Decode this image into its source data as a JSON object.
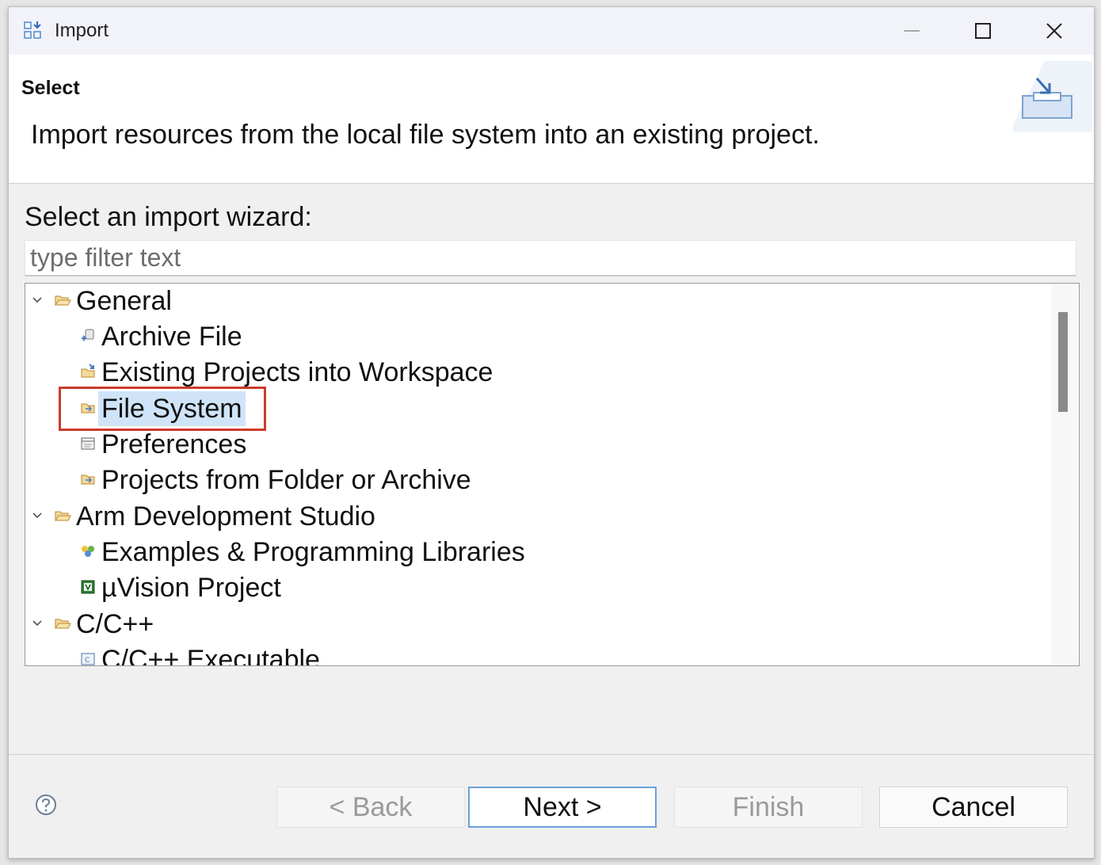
{
  "window": {
    "title": "Import",
    "icons": {
      "app": "import-wizard-icon",
      "minimize": "minimize-icon",
      "maximize": "maximize-icon",
      "close": "close-icon"
    }
  },
  "header": {
    "title": "Select",
    "description": "Import resources from the local file system into an existing project.",
    "banner_icon": "import-banner-icon"
  },
  "wizard": {
    "label": "Select an import wizard:",
    "filter_placeholder": "type filter text",
    "tree": [
      {
        "label": "General",
        "type": "category",
        "icon": "folder-open-icon",
        "expanded": true
      },
      {
        "label": "Archive File",
        "type": "item",
        "icon": "archive-file-icon"
      },
      {
        "label": "Existing Projects into Workspace",
        "type": "item",
        "icon": "existing-projects-icon"
      },
      {
        "label": "File System",
        "type": "item",
        "icon": "folder-icon",
        "selected": true
      },
      {
        "label": "Preferences",
        "type": "item",
        "icon": "preferences-icon"
      },
      {
        "label": "Projects from Folder or Archive",
        "type": "item",
        "icon": "folder-icon"
      },
      {
        "label": "Arm Development Studio",
        "type": "category",
        "icon": "folder-open-icon",
        "expanded": true
      },
      {
        "label": "Examples & Programming Libraries",
        "type": "item",
        "icon": "examples-icon"
      },
      {
        "label": "µVision Project",
        "type": "item",
        "icon": "uvision-project-icon"
      },
      {
        "label": "C/C++",
        "type": "category",
        "icon": "folder-open-icon",
        "expanded": true
      },
      {
        "label": "C/C++ Executable",
        "type": "item",
        "icon": "executable-icon"
      }
    ]
  },
  "footer": {
    "help_icon": "help-icon",
    "buttons": {
      "back": "< Back",
      "next": "Next >",
      "finish": "Finish",
      "cancel": "Cancel"
    }
  },
  "colors": {
    "highlight_box": "#cc3b2c",
    "selection": "#cfe4f8",
    "default_button_border": "#6a9fd8"
  }
}
